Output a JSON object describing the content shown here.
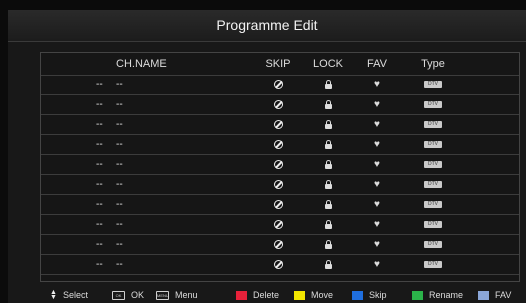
{
  "title": "Programme Edit",
  "columns": {
    "name": "CH.NAME",
    "skip": "SKIP",
    "lock": "LOCK",
    "fav": "FAV",
    "type": "Type"
  },
  "rows": [
    {
      "num": "--",
      "name": "--",
      "type_label": "DTV"
    },
    {
      "num": "--",
      "name": "--",
      "type_label": "DTV"
    },
    {
      "num": "--",
      "name": "--",
      "type_label": "DTV"
    },
    {
      "num": "--",
      "name": "--",
      "type_label": "DTV"
    },
    {
      "num": "--",
      "name": "--",
      "type_label": "DTV"
    },
    {
      "num": "--",
      "name": "--",
      "type_label": "DTV"
    },
    {
      "num": "--",
      "name": "--",
      "type_label": "DTV"
    },
    {
      "num": "--",
      "name": "--",
      "type_label": "DTV"
    },
    {
      "num": "--",
      "name": "--",
      "type_label": "DTV"
    },
    {
      "num": "--",
      "name": "--",
      "type_label": "DTV"
    }
  ],
  "footer": {
    "select": "Select",
    "ok_key": "OK",
    "ok": "OK",
    "menu_key": "MENU",
    "menu": "Menu",
    "delete": "Delete",
    "move": "Move",
    "skip": "Skip",
    "rename": "Rename",
    "fav": "FAV"
  },
  "colors": {
    "delete": "#e8213a",
    "move": "#f2e600",
    "skip": "#1f6fe0",
    "rename": "#2bb34a",
    "fav": "#8aa6d8"
  },
  "icons": {
    "skip": "skip-icon",
    "lock": "lock-icon",
    "fav": "heart-icon"
  }
}
